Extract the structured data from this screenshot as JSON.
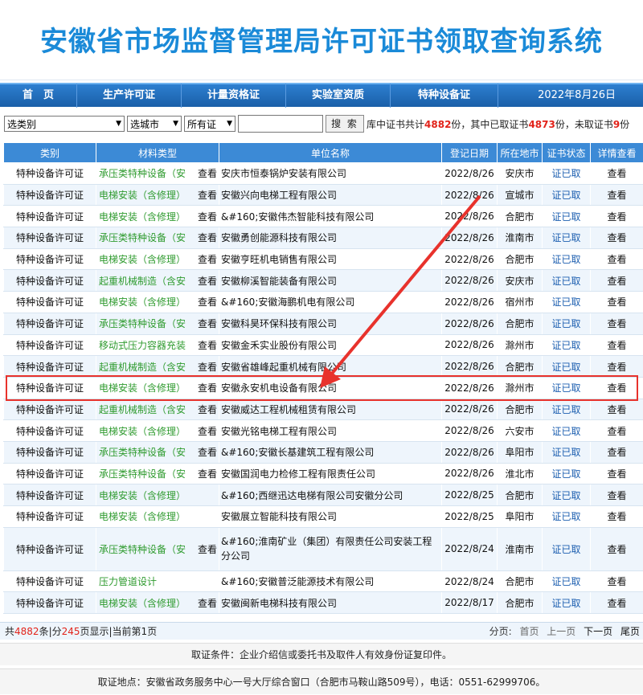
{
  "header": {
    "title": "安徽省市场监督管理局许可证书领取查询系统"
  },
  "nav": {
    "items": [
      "首　页",
      "生产许可证",
      "计量资格证",
      "实验室资质",
      "特种设备证"
    ],
    "date": "2022年8月26日"
  },
  "search": {
    "type_select": "选类别",
    "city_select": "选城市",
    "cert_select": "所有证",
    "button": "搜 索",
    "stats_prefix": "库中证书共计",
    "total": "4882",
    "stats_mid": "份，其中已取证书",
    "taken": "4873",
    "stats_mid2": "份，未取证书",
    "untaken": "9",
    "stats_suffix": "份"
  },
  "table": {
    "headers": [
      "类别",
      "材料类型",
      "单位名称",
      "登记日期",
      "所在地市",
      "证书状态",
      "详情查看"
    ],
    "rows": [
      {
        "cat": "特种设备许可证",
        "mat": "承压类特种设备（安",
        "look": "查看",
        "unit": "安庆市恒泰锅炉安装有限公司",
        "date": "2022/8/26",
        "city": "安庆市",
        "status": "证已取",
        "detail": "查看"
      },
      {
        "cat": "特种设备许可证",
        "mat": "电梯安装（含修理）",
        "look": "查看",
        "unit": "安徽兴向电梯工程有限公司",
        "date": "2022/8/26",
        "city": "宣城市",
        "status": "证已取",
        "detail": "查看"
      },
      {
        "cat": "特种设备许可证",
        "mat": "电梯安装（含修理）",
        "look": "查看",
        "unit": "&#160;安徽伟杰智能科技有限公司",
        "date": "2022/8/26",
        "city": "合肥市",
        "status": "证已取",
        "detail": "查看"
      },
      {
        "cat": "特种设备许可证",
        "mat": "承压类特种设备（安",
        "look": "查看",
        "unit": "安徽勇创能源科技有限公司",
        "date": "2022/8/26",
        "city": "淮南市",
        "status": "证已取",
        "detail": "查看"
      },
      {
        "cat": "特种设备许可证",
        "mat": "电梯安装（含修理）",
        "look": "查看",
        "unit": "安徽亨旺机电销售有限公司",
        "date": "2022/8/26",
        "city": "合肥市",
        "status": "证已取",
        "detail": "查看"
      },
      {
        "cat": "特种设备许可证",
        "mat": "起重机械制造（含安",
        "look": "查看",
        "unit": "安徽柳溪智能装备有限公司",
        "date": "2022/8/26",
        "city": "安庆市",
        "status": "证已取",
        "detail": "查看"
      },
      {
        "cat": "特种设备许可证",
        "mat": "电梯安装（含修理）",
        "look": "查看",
        "unit": "&#160;安徽海鹏机电有限公司",
        "date": "2022/8/26",
        "city": "宿州市",
        "status": "证已取",
        "detail": "查看"
      },
      {
        "cat": "特种设备许可证",
        "mat": "承压类特种设备（安",
        "look": "查看",
        "unit": "安徽科昊环保科技有限公司",
        "date": "2022/8/26",
        "city": "合肥市",
        "status": "证已取",
        "detail": "查看"
      },
      {
        "cat": "特种设备许可证",
        "mat": "移动式压力容器充装",
        "look": "查看",
        "unit": "安徽金禾实业股份有限公司",
        "date": "2022/8/26",
        "city": "滁州市",
        "status": "证已取",
        "detail": "查看"
      },
      {
        "cat": "特种设备许可证",
        "mat": "起重机械制造（含安",
        "look": "查看",
        "unit": "安徽省雄峰起重机械有限公司",
        "date": "2022/8/26",
        "city": "合肥市",
        "status": "证已取",
        "detail": "查看"
      },
      {
        "cat": "特种设备许可证",
        "mat": "电梯安装（含修理）",
        "look": "查看",
        "unit": "安徽永安机电设备有限公司",
        "date": "2022/8/26",
        "city": "滁州市",
        "status": "证已取",
        "detail": "查看"
      },
      {
        "cat": "特种设备许可证",
        "mat": "起重机械制造（含安",
        "look": "查看",
        "unit": "安徽威达工程机械租赁有限公司",
        "date": "2022/8/26",
        "city": "合肥市",
        "status": "证已取",
        "detail": "查看"
      },
      {
        "cat": "特种设备许可证",
        "mat": "电梯安装（含修理）",
        "look": "查看",
        "unit": "安徽光铭电梯工程有限公司",
        "date": "2022/8/26",
        "city": "六安市",
        "status": "证已取",
        "detail": "查看"
      },
      {
        "cat": "特种设备许可证",
        "mat": "承压类特种设备（安",
        "look": "查看",
        "unit": "&#160;安徽长基建筑工程有限公司",
        "date": "2022/8/26",
        "city": "阜阳市",
        "status": "证已取",
        "detail": "查看"
      },
      {
        "cat": "特种设备许可证",
        "mat": "承压类特种设备（安",
        "look": "查看",
        "unit": "安徽国润电力检修工程有限责任公司",
        "date": "2022/8/26",
        "city": "淮北市",
        "status": "证已取",
        "detail": "查看"
      },
      {
        "cat": "特种设备许可证",
        "mat": "电梯安装（含修理）",
        "look": "",
        "unit": "&#160;西继迅达电梯有限公司安徽分公司",
        "date": "2022/8/25",
        "city": "合肥市",
        "status": "证已取",
        "detail": "查看"
      },
      {
        "cat": "特种设备许可证",
        "mat": "电梯安装（含修理）",
        "look": "",
        "unit": "安徽展立智能科技有限公司",
        "date": "2022/8/25",
        "city": "阜阳市",
        "status": "证已取",
        "detail": "查看"
      },
      {
        "cat": "特种设备许可证",
        "mat": "承压类特种设备（安",
        "look": "查看",
        "unit": "&#160;淮南矿业（集团）有限责任公司安装工程分公司",
        "date": "2022/8/24",
        "city": "淮南市",
        "status": "证已取",
        "detail": "查看",
        "tall": true
      },
      {
        "cat": "特种设备许可证",
        "mat": "压力管道设计",
        "look": "",
        "unit": "&#160;安徽普泛能源技术有限公司",
        "date": "2022/8/24",
        "city": "合肥市",
        "status": "证已取",
        "detail": "查看"
      },
      {
        "cat": "特种设备许可证",
        "mat": "电梯安装（含修理）",
        "look": "查看",
        "unit": "安徽闽新电梯科技有限公司",
        "date": "2022/8/17",
        "city": "合肥市",
        "status": "证已取",
        "detail": "查看"
      }
    ]
  },
  "footer": {
    "count_prefix": "共",
    "count": "4882",
    "count_mid": "条|分",
    "pages": "245",
    "count_suffix": "页显示|当前第1页",
    "pager_label": "分页:",
    "first": "首页",
    "prev": "上一页",
    "next": "下一页",
    "last": "尾页",
    "condition": "取证条件：企业介绍信或委托书及取件人有效身份证复印件。",
    "address": "取证地点：安徽省政务服务中心一号大厅综合窗口（合肥市马鞍山路509号），电话：0551-62999706。"
  },
  "colors": {
    "title": "#1a8ad8",
    "nav": "#1a5fa8",
    "header_row": "#3c8ad6",
    "material": "#2f9b2f",
    "status": "#1d5fb0",
    "highlight": "#e8322c"
  }
}
